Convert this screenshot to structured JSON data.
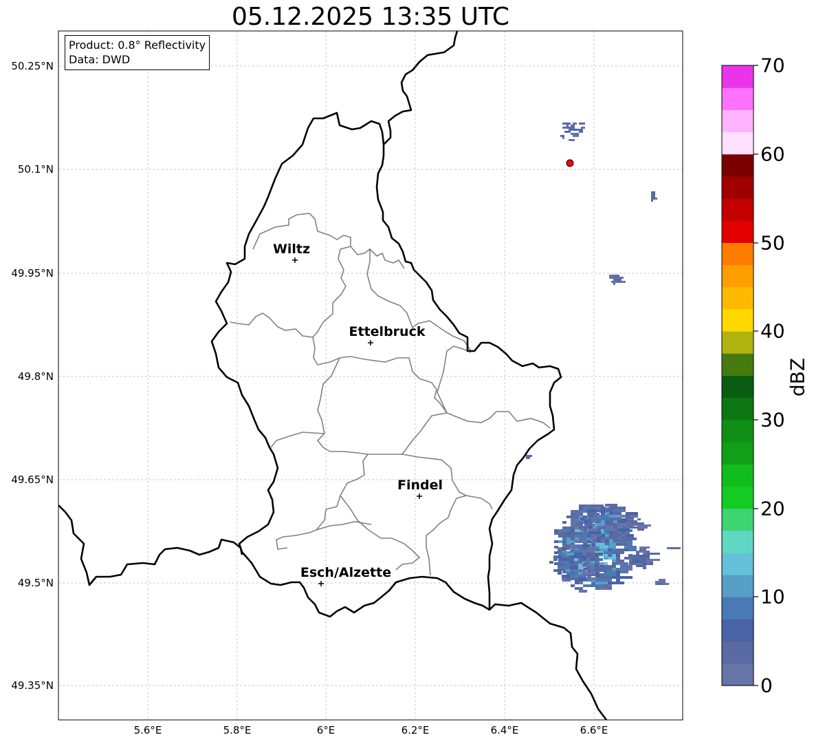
{
  "title": "05.12.2025 13:35 UTC",
  "info": {
    "product": "Product: 0.8° Reflectivity",
    "data": "Data: DWD"
  },
  "lat_labels": [
    "50.25°N",
    "50.1°N",
    "49.95°N",
    "49.8°N",
    "49.65°N",
    "49.5°N",
    "49.35°N"
  ],
  "lon_labels": [
    "5.6°E",
    "5.8°E",
    "6°E",
    "6.2°E",
    "6.4°E",
    "6.6°E"
  ],
  "cities": [
    {
      "name": "Wiltz"
    },
    {
      "name": "Ettelbruck"
    },
    {
      "name": "Findel"
    },
    {
      "name": "Esch/Alzette"
    }
  ],
  "radar_site_marker": {
    "color": "#ff0000"
  },
  "colorbar": {
    "label": "dBZ",
    "ticks": [
      "0",
      "10",
      "20",
      "30",
      "40",
      "50",
      "60",
      "70"
    ],
    "min": 0,
    "max": 70,
    "step": 2.5,
    "colors": [
      "#6674a8",
      "#5a6aa3",
      "#4a62a6",
      "#4a7ab5",
      "#579fc7",
      "#64c0d9",
      "#5ed8c3",
      "#3dd572",
      "#13cb23",
      "#13bc1d",
      "#129e16",
      "#108f16",
      "#0c7713",
      "#0a5d10",
      "#467a0f",
      "#b0b30d",
      "#ffd800",
      "#feba00",
      "#ff9e00",
      "#ff7c00",
      "#e20000",
      "#c20000",
      "#a00000",
      "#7a0000",
      "#ffe0ff",
      "#ffb4ff",
      "#ff72ff",
      "#ea34ea"
    ]
  }
}
